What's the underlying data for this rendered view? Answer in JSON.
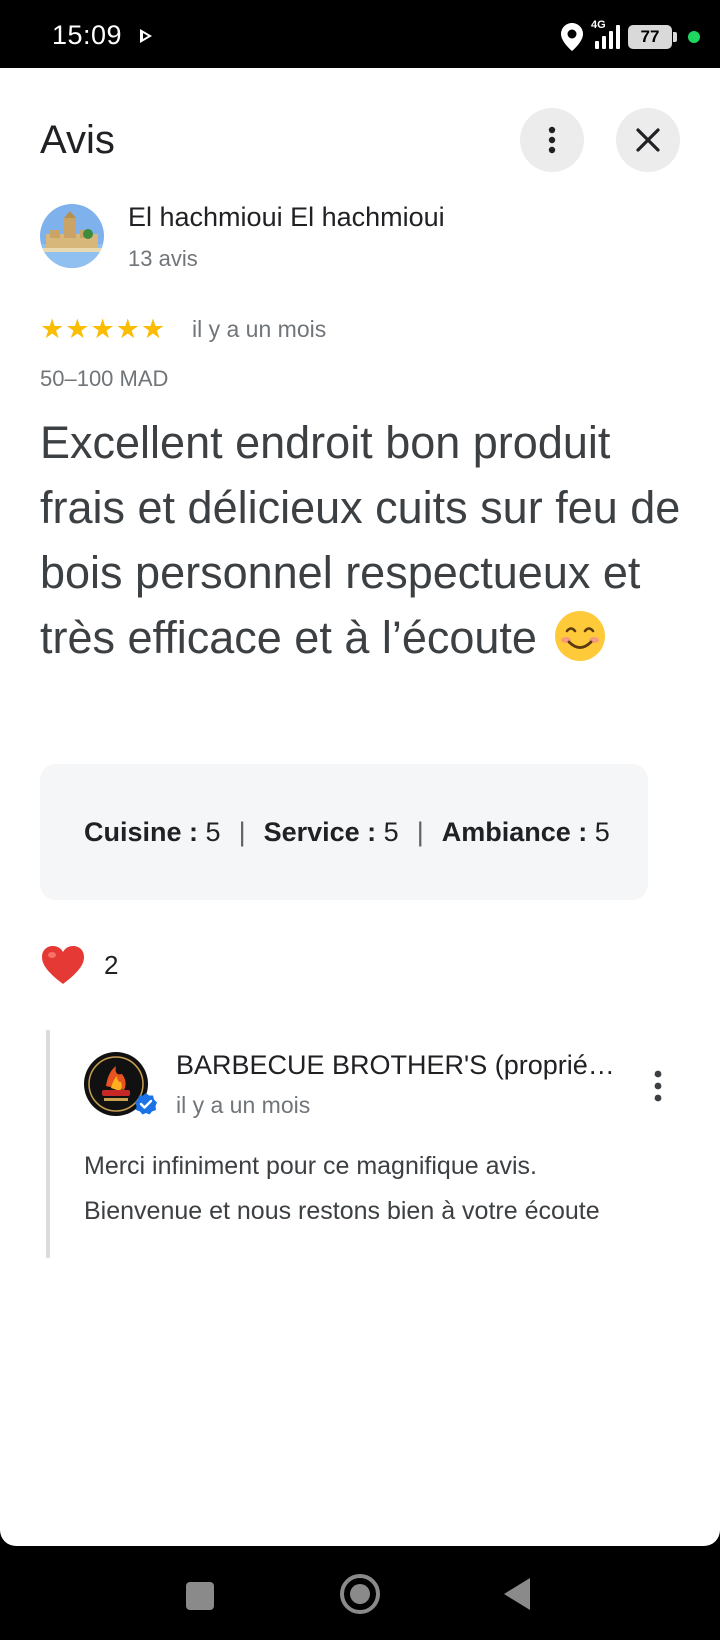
{
  "status_bar": {
    "time": "15:09",
    "network": "4G",
    "battery": "77"
  },
  "header": {
    "title": "Avis",
    "more_icon": "more-vert-icon",
    "close_icon": "close-icon"
  },
  "review": {
    "author_name": "El hachmioui El hachmioui",
    "author_review_count": "13 avis",
    "rating": 5,
    "rating_max": 5,
    "date": "il y a un mois",
    "price_range": "50–100 MAD",
    "text": "Excellent endroit bon produit frais et délicieux cuits sur feu de bois personnel respectueux et très efficace et à l’écoute",
    "sub_ratings": [
      {
        "label": "Cuisine :",
        "value": "5"
      },
      {
        "label": "Service :",
        "value": "5"
      },
      {
        "label": "Ambiance :",
        "value": "5"
      }
    ],
    "separator": "|",
    "likes": "2"
  },
  "owner_reply": {
    "name": "BARBECUE BROTHER'S (proprié…",
    "date": "il y a un mois",
    "text_line1": "Merci infiniment pour ce magnifique avis.",
    "text_line2": "Bienvenue et nous restons bien à votre écoute"
  },
  "colors": {
    "star": "#fbbc04",
    "heart": "#e53935",
    "verified": "#1a73e8"
  }
}
